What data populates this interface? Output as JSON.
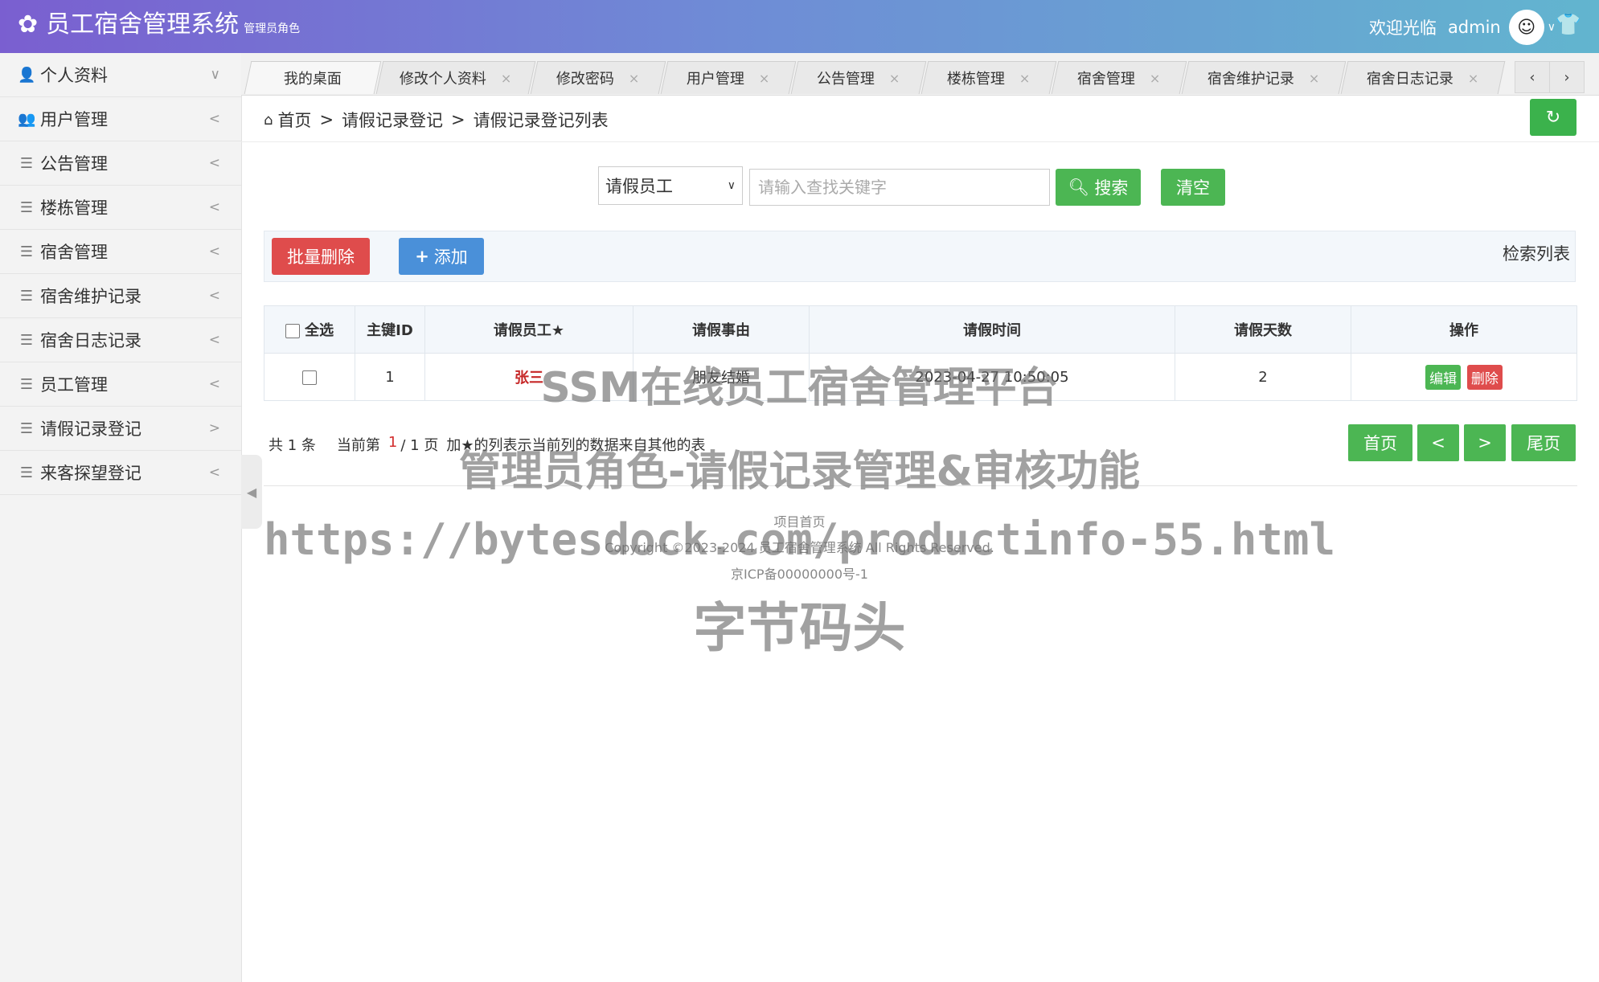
{
  "header": {
    "title": "员工宿舍管理系统",
    "role": "管理员角色",
    "welcome": "欢迎光临",
    "username": "admin"
  },
  "sidebar": {
    "items": [
      {
        "label": "个人资料",
        "icon": "user-icon",
        "arrow": "∨"
      },
      {
        "label": "用户管理",
        "icon": "users-icon",
        "arrow": "<"
      },
      {
        "label": "公告管理",
        "icon": "menu-icon",
        "arrow": "<"
      },
      {
        "label": "楼栋管理",
        "icon": "menu-icon",
        "arrow": "<"
      },
      {
        "label": "宿舍管理",
        "icon": "menu-icon",
        "arrow": "<"
      },
      {
        "label": "宿舍维护记录",
        "icon": "menu-icon",
        "arrow": "<"
      },
      {
        "label": "宿舍日志记录",
        "icon": "menu-icon",
        "arrow": "<"
      },
      {
        "label": "员工管理",
        "icon": "menu-icon",
        "arrow": "<"
      },
      {
        "label": "请假记录登记",
        "icon": "menu-icon",
        "arrow": ">"
      },
      {
        "label": "来客探望登记",
        "icon": "menu-icon",
        "arrow": "<"
      }
    ]
  },
  "tabs": [
    {
      "label": "我的桌面"
    },
    {
      "label": "修改个人资料"
    },
    {
      "label": "修改密码"
    },
    {
      "label": "用户管理"
    },
    {
      "label": "公告管理"
    },
    {
      "label": "楼栋管理"
    },
    {
      "label": "宿舍管理"
    },
    {
      "label": "宿舍维护记录"
    },
    {
      "label": "宿舍日志记录"
    }
  ],
  "tab_close": "×",
  "breadcrumb": {
    "home": "首页",
    "sep": ">",
    "level1": "请假记录登记",
    "level2": "请假记录登记列表"
  },
  "search": {
    "field_selected": "请假员工",
    "placeholder": "请输入查找关键字",
    "search_label": "搜索",
    "clear_label": "清空"
  },
  "toolbar": {
    "batch_delete": "批量删除",
    "add": "添加",
    "list_title": "检索列表"
  },
  "table": {
    "headers": [
      "全选",
      "主键ID",
      "请假员工★",
      "请假事由",
      "请假时间",
      "请假天数",
      "操作"
    ],
    "rows": [
      {
        "id": "1",
        "employee": "张三",
        "reason": "朋友结婚",
        "time": "2023-04-27 10:50:05",
        "days": "2",
        "edit": "编辑",
        "delete": "删除"
      }
    ]
  },
  "pagination": {
    "total": "共 1 条",
    "current_prefix": "当前第",
    "current": "1",
    "current_suffix": "/ 1 页",
    "note": "加★的列表示当前列的数据来自其他的表",
    "first": "首页",
    "prev": "<",
    "next": ">",
    "last": "尾页"
  },
  "footer": {
    "link": "项目首页",
    "copyright": "Copyright ©2023-2024 员工宿舍管理系统 All Rights Reserved.",
    "icp": "京ICP备00000000号-1"
  },
  "watermark": {
    "line1": "SSM在线员工宿舍管理平台",
    "line2": "管理员角色-请假记录管理&审核功能",
    "line3": "https://bytesdock.com/productinfo-55.html",
    "line4": "字节码头"
  },
  "colors": {
    "header_start": "#7a5fd0",
    "header_end": "#62b5cf",
    "green": "#4cb653",
    "red": "#df4c4c",
    "blue": "#4a90d9"
  }
}
